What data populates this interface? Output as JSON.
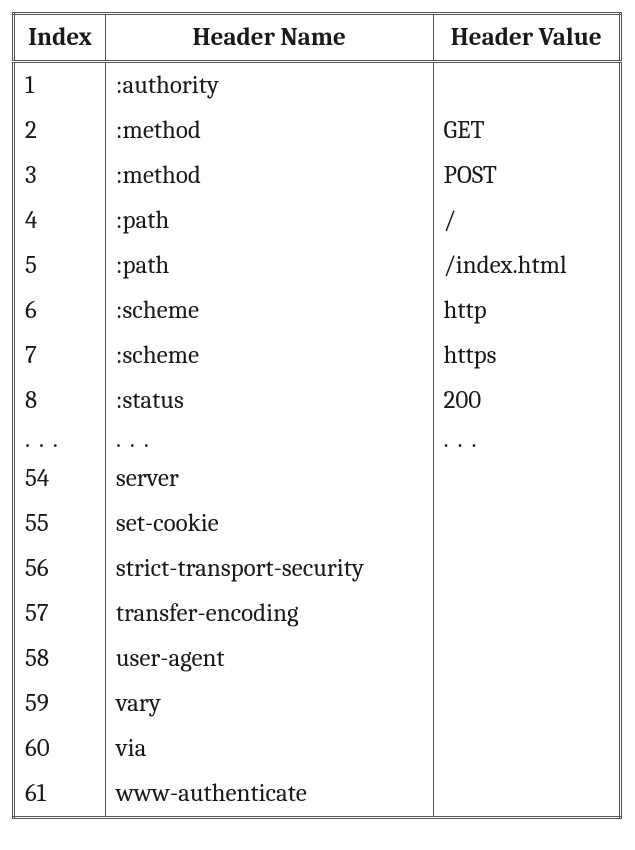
{
  "table": {
    "headers": {
      "index": "Index",
      "name": "Header Name",
      "value": "Header Value"
    },
    "rows": [
      {
        "index": "1",
        "name": ":authority",
        "value": ""
      },
      {
        "index": "2",
        "name": ":method",
        "value": "GET"
      },
      {
        "index": "3",
        "name": ":method",
        "value": "POST"
      },
      {
        "index": "4",
        "name": ":path",
        "value": "/"
      },
      {
        "index": "5",
        "name": ":path",
        "value": "/index.html"
      },
      {
        "index": "6",
        "name": ":scheme",
        "value": "http"
      },
      {
        "index": "7",
        "name": ":scheme",
        "value": "https"
      },
      {
        "index": "8",
        "name": ":status",
        "value": "200"
      },
      {
        "index": ". . .",
        "name": " . . .",
        "value": ". . .",
        "ellipsis": true
      },
      {
        "index": "54",
        "name": "server",
        "value": ""
      },
      {
        "index": "55",
        "name": "set-cookie",
        "value": ""
      },
      {
        "index": "56",
        "name": "strict-transport-security",
        "value": ""
      },
      {
        "index": "57",
        "name": "transfer-encoding",
        "value": ""
      },
      {
        "index": "58",
        "name": "user-agent",
        "value": ""
      },
      {
        "index": "59",
        "name": "vary",
        "value": ""
      },
      {
        "index": "60",
        "name": "via",
        "value": ""
      },
      {
        "index": "61",
        "name": "www-authenticate",
        "value": ""
      }
    ]
  }
}
